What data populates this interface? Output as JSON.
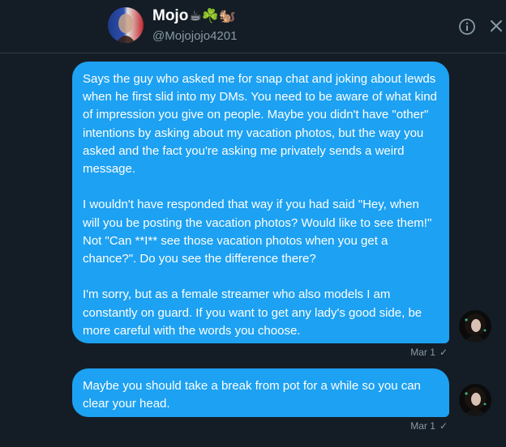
{
  "header": {
    "name": "Mojo",
    "emoji": "☕☘️🐿️",
    "handle": "@Mojojojo4201"
  },
  "messages": [
    {
      "paragraphs": [
        "Says the guy who asked me for snap chat and joking about lewds when he first slid into my DMs. You need to be aware of what kind of impression you give on people. Maybe you didn't have \"other\" intentions by asking about my vacation photos, but the way you asked and the fact you're asking me privately sends a weird message.",
        "I wouldn't have responded that way if you had said \"Hey, when will you be posting the vacation photos? Would like to see them!\" Not \"Can **I** see those vacation photos when you get a chance?\". Do you see the difference there?",
        "I'm sorry, but as a female streamer who also models I am constantly on guard. If you want to get any lady's good side, be more careful with the words you choose."
      ],
      "timestamp": "Mar 1",
      "status": "✓"
    },
    {
      "paragraphs": [
        "Maybe you should take a break from pot for a while so you can clear your head."
      ],
      "timestamp": "Mar 1",
      "status": "✓"
    }
  ],
  "colors": {
    "background": "#141d26",
    "bubble": "#1da1f2",
    "muted": "#8899a6"
  },
  "icons": {
    "info": "info-icon",
    "close": "close-icon"
  }
}
